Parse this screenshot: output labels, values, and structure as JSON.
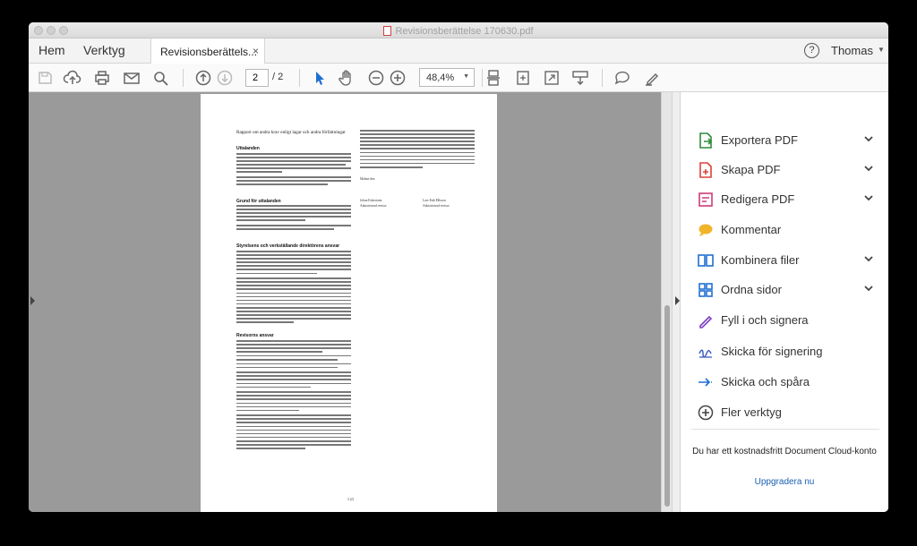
{
  "window": {
    "title": "Revisionsberättelse 170630.pdf"
  },
  "menu": {
    "home": "Hem",
    "tools": "Verktyg"
  },
  "tab": {
    "label": "Revisionsberättels...",
    "close": "×"
  },
  "header": {
    "help": "?",
    "user": "Thomas",
    "user_caret": "▼"
  },
  "toolbar": {
    "icons": [
      "save-icon",
      "upload-icon",
      "print-icon",
      "mail-icon",
      "search-icon",
      "arrow-up-icon",
      "arrow-down-icon",
      "select-arrow-icon",
      "hand-icon",
      "zoom-out-icon",
      "zoom-in-icon"
    ],
    "page_current": "2",
    "page_total": "/ 2",
    "zoom": "48,4%",
    "zoom_caret": "▼"
  },
  "document": {
    "page_title": "Rapport om andra krav enligt lagar och andra författningar",
    "headings": [
      "Uttalanden",
      "Grund för uttalanden",
      "Styrelsens och verkställande direktörens ansvar",
      "Revisorns ansvar"
    ],
    "place_date": "Malmö den",
    "signer_1_name": "Johan Eskestrom",
    "signer_1_role": "Auktoriserad revisor",
    "signer_2_name": "Lars-Erik Pålsson",
    "signer_2_role": "Auktoriserad revisor",
    "page_number": "2 (2)"
  },
  "right_panel": {
    "tools": [
      {
        "label": "Exportera PDF",
        "icon": "export-pdf-icon",
        "color": "#2e8b3a",
        "expandable": true
      },
      {
        "label": "Skapa PDF",
        "icon": "create-pdf-icon",
        "color": "#d9433b",
        "expandable": true
      },
      {
        "label": "Redigera PDF",
        "icon": "edit-pdf-icon",
        "color": "#d0397a",
        "expandable": true
      },
      {
        "label": "Kommentar",
        "icon": "comment-icon",
        "color": "#f0b429",
        "expandable": false
      },
      {
        "label": "Kombinera filer",
        "icon": "combine-files-icon",
        "color": "#1f6fd1",
        "expandable": true
      },
      {
        "label": "Ordna sidor",
        "icon": "organize-pages-icon",
        "color": "#1f6fd1",
        "expandable": true
      },
      {
        "label": "Fyll i och signera",
        "icon": "fill-sign-icon",
        "color": "#7b3fc4",
        "expandable": false
      },
      {
        "label": "Skicka för signering",
        "icon": "send-signature-icon",
        "color": "#3f5fc4",
        "expandable": false
      },
      {
        "label": "Skicka och spåra",
        "icon": "send-track-icon",
        "color": "#1f6fd1",
        "expandable": false
      },
      {
        "label": "Fler verktyg",
        "icon": "more-tools-icon",
        "color": "#444444",
        "expandable": false
      }
    ],
    "promo": "Du har ett kostnadsfritt Document Cloud-konto",
    "upgrade": "Uppgradera nu"
  }
}
